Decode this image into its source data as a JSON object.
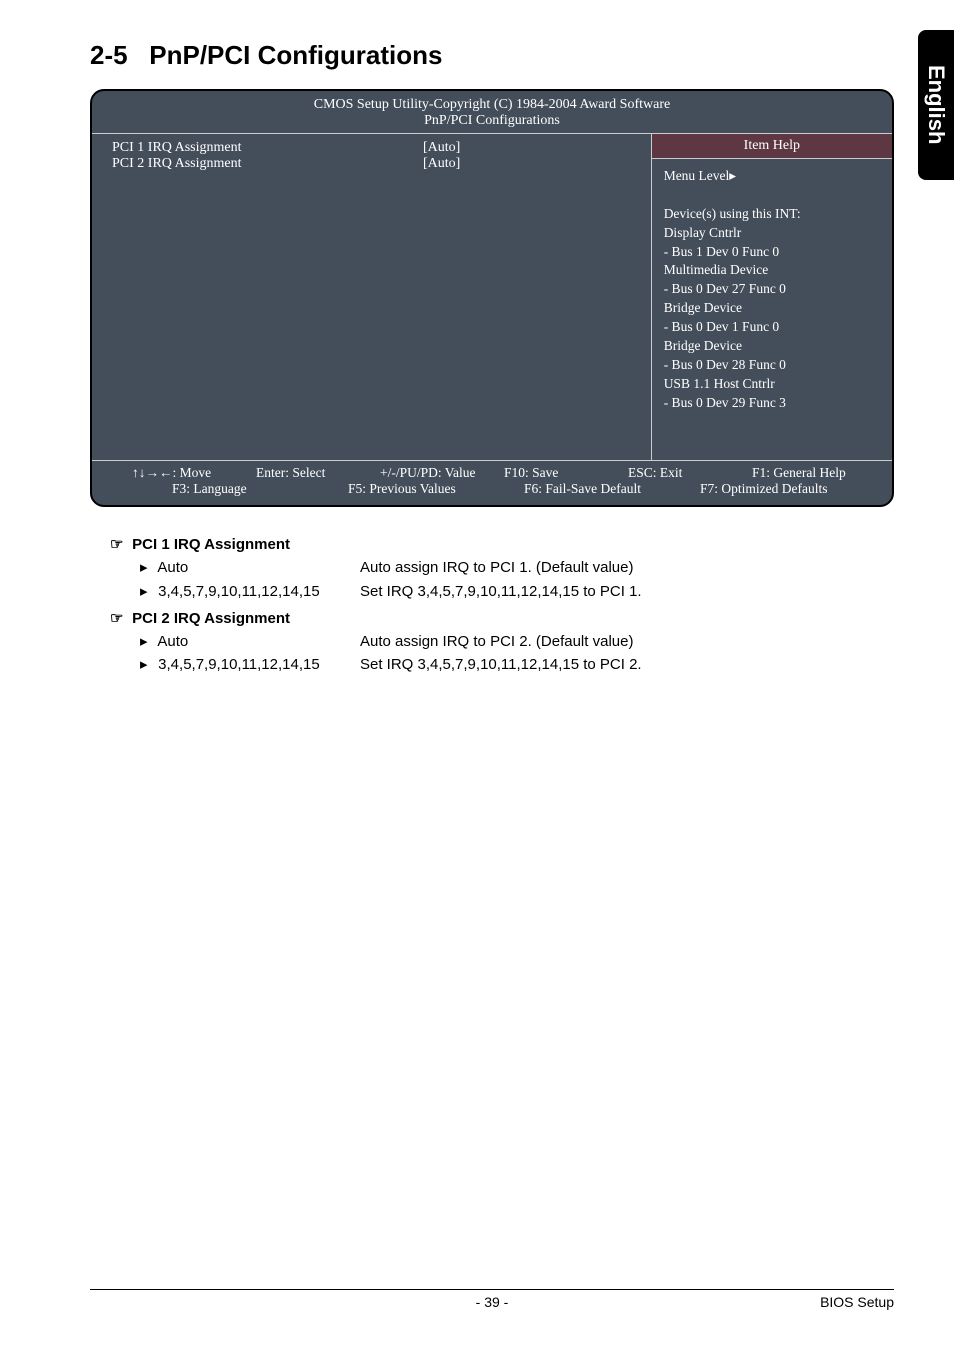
{
  "sideTab": "English",
  "section": {
    "number": "2-5",
    "title": "PnP/PCI Configurations"
  },
  "bios": {
    "header1": "CMOS Setup Utility-Copyright (C) 1984-2004 Award Software",
    "header2": "PnP/PCI Configurations",
    "rows": [
      {
        "label": "PCI 1 IRQ Assignment",
        "value": "[Auto]"
      },
      {
        "label": "PCI 2 IRQ Assignment",
        "value": "[Auto]"
      }
    ],
    "rightHead": "Item Help",
    "menuLevel": "Menu Level▸",
    "helpLines": [
      "Device(s) using this INT:",
      "",
      "Display Cntrlr",
      "- Bus 1 Dev 0 Func 0",
      "Multimedia Device",
      "- Bus 0 Dev 27 Func 0",
      "Bridge Device",
      "- Bus 0 Dev 1 Func 0",
      "Bridge Device",
      "- Bus 0 Dev 28 Func 0",
      "USB 1.1 Host Cntrlr",
      "- Bus 0 Dev 29 Func 3"
    ],
    "footer": {
      "row1": [
        "↑↓→←: Move",
        "Enter: Select",
        "+/-/PU/PD: Value",
        "F10: Save",
        "ESC: Exit",
        "F1: General Help"
      ],
      "row2": [
        "F3: Language",
        "F5: Previous Values",
        "F6: Fail-Save Default",
        "F7: Optimized Defaults"
      ]
    }
  },
  "desc": {
    "items": [
      {
        "title": "PCI 1 IRQ Assignment",
        "lines": [
          {
            "opt": "Auto",
            "text": "Auto assign IRQ to PCI 1. (Default value)"
          },
          {
            "opt": "3,4,5,7,9,10,11,12,14,15",
            "text": "Set IRQ 3,4,5,7,9,10,11,12,14,15 to PCI 1."
          }
        ]
      },
      {
        "title": "PCI 2 IRQ Assignment",
        "lines": [
          {
            "opt": "Auto",
            "text": "Auto assign IRQ to PCI 2. (Default value)"
          },
          {
            "opt": "3,4,5,7,9,10,11,12,14,15",
            "text": "Set IRQ 3,4,5,7,9,10,11,12,14,15 to PCI 2."
          }
        ]
      }
    ]
  },
  "footer": {
    "pageNum": "- 39 -",
    "right": "BIOS Setup"
  },
  "glyphs": {
    "hand": "☞",
    "arrow": "▸"
  }
}
